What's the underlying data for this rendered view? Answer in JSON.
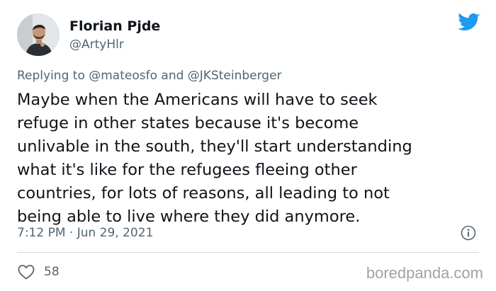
{
  "author": {
    "display_name": "Florian Pjde",
    "handle": "@ArtyHlr"
  },
  "reply": {
    "prefix": "Replying to",
    "mention_1": "@mateosfo",
    "conjunction": "and",
    "mention_2": "@JKSteinberger"
  },
  "tweet": {
    "text": "Maybe when the Americans will have to seek\nrefuge in other states because it's become\nunlivable in the south, they'll start understanding\nwhat it's like for the refugees fleeing other\ncountries, for lots of reasons, all leading to not\nbeing able to live where they did anymore.",
    "timestamp": "7:12 PM · Jun 29, 2021"
  },
  "engagement": {
    "likes": "58"
  },
  "watermark": "boredpanda.com",
  "colors": {
    "twitter_blue": "#1d9bf0",
    "secondary_text": "#536471",
    "divider": "#cfd9de",
    "watermark": "#9aa4ab"
  },
  "icons": {
    "brand": "twitter-bird-icon",
    "info": "info-icon",
    "like": "heart-icon"
  }
}
